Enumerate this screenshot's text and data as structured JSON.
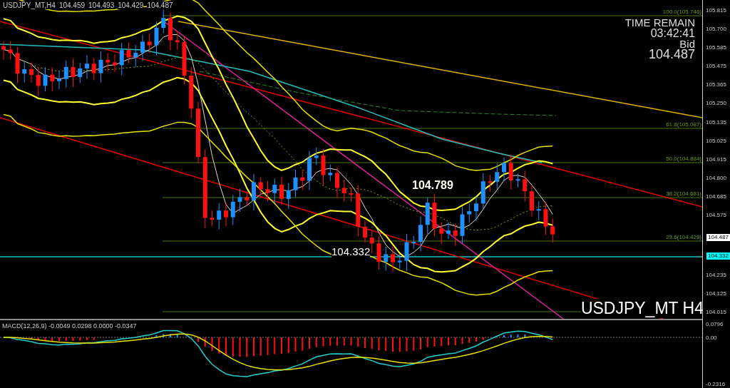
{
  "chart": {
    "symbol": "USDJPY_MT,H4",
    "ohlc": [
      "104.459",
      "104.493",
      "104.429",
      "104.487"
    ],
    "timer": {
      "title": "TIME REMAIN",
      "time": "03:42:41",
      "bid_label": "Bid",
      "bid": "104.487"
    },
    "price_labels": [
      "104.789",
      "104.332"
    ],
    "fib_levels": [
      {
        "label": "100.0(105.746)"
      },
      {
        "label": "61.8(105.087)"
      },
      {
        "label": "50.0(104.884)"
      },
      {
        "label": "38.2(104.681)"
      },
      {
        "label": "23.6(104.429)"
      }
    ],
    "symbol_label": "USDJPY_MT H4"
  },
  "price_axis": [
    {
      "kind": "tick",
      "text": "105.815"
    },
    {
      "kind": "tick",
      "text": "105.700"
    },
    {
      "kind": "tick",
      "text": "105.585"
    },
    {
      "kind": "tick",
      "text": "105.475"
    },
    {
      "kind": "tick",
      "text": "105.365"
    },
    {
      "kind": "tick",
      "text": "105.250"
    },
    {
      "kind": "tick",
      "text": "105.135"
    },
    {
      "kind": "tick",
      "text": "105.025"
    },
    {
      "kind": "tick",
      "text": "104.915"
    },
    {
      "kind": "tick",
      "text": "104.800"
    },
    {
      "kind": "tick",
      "text": "104.685"
    },
    {
      "kind": "tick",
      "text": "104.575"
    },
    {
      "kind": "tag",
      "text": "104.487",
      "color": "#ffffff"
    },
    {
      "kind": "tag",
      "text": "104.332",
      "color": "#00ffff"
    },
    {
      "kind": "tick",
      "text": "104.235"
    },
    {
      "kind": "tick",
      "text": "104.125"
    },
    {
      "kind": "tick",
      "text": "104.015"
    }
  ],
  "macd": {
    "label": "MACD(12,26,9) -0.0049 0.0298 0.0000 -0.0347",
    "axis": [
      "0.0796",
      "0.00",
      "-0.2316"
    ]
  }
}
